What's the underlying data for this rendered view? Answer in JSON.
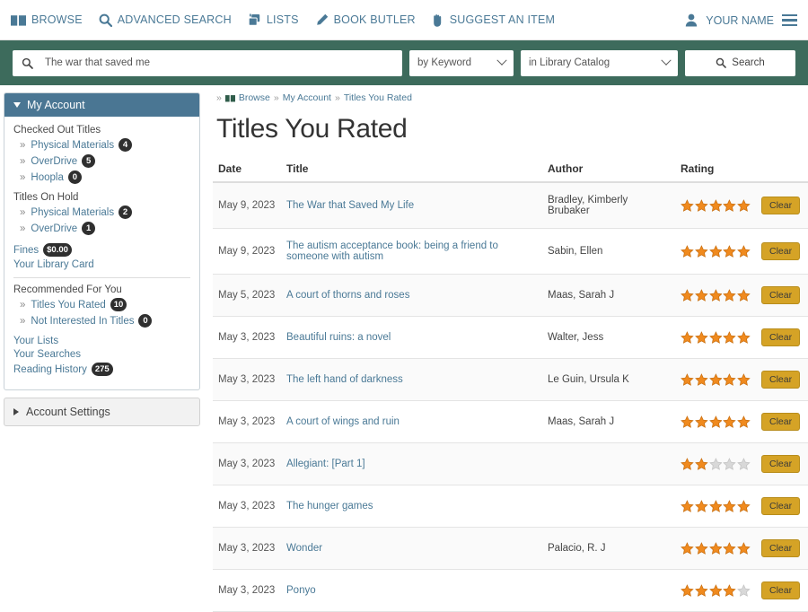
{
  "topnav": {
    "items": [
      {
        "label": "BROWSE",
        "icon": "book-icon"
      },
      {
        "label": "ADVANCED SEARCH",
        "icon": "search-icon"
      },
      {
        "label": "LISTS",
        "icon": "lists-icon"
      },
      {
        "label": "BOOK BUTLER",
        "icon": "pencil-icon"
      },
      {
        "label": "SUGGEST AN ITEM",
        "icon": "hand-icon"
      }
    ],
    "account_label": "YOUR NAME",
    "account_icon": "user-icon",
    "menu_icon": "hamburger-icon"
  },
  "search": {
    "query": "The war that saved me",
    "placeholder": "The war that saved me",
    "field_select": "by Keyword",
    "scope_select": "in Library Catalog",
    "button_label": "Search",
    "band_color": "#3d6b5c"
  },
  "sidebar": {
    "header": "My Account",
    "header_color": "#4a7693",
    "groups": [
      {
        "title": "Checked Out Titles",
        "items": [
          {
            "label": "Physical Materials",
            "count": "4"
          },
          {
            "label": "OverDrive",
            "count": "5"
          },
          {
            "label": "Hoopla",
            "count": "0"
          }
        ]
      },
      {
        "title": "Titles On Hold",
        "items": [
          {
            "label": "Physical Materials",
            "count": "2"
          },
          {
            "label": "OverDrive",
            "count": "1"
          }
        ]
      }
    ],
    "fines_label": "Fines",
    "fines_amount": "$0.00",
    "library_card_label": "Your Library Card",
    "recommended_title": "Recommended For You",
    "recommended_items": [
      {
        "label": "Titles You Rated",
        "count": "10"
      },
      {
        "label": "Not Interested In Titles",
        "count": "0"
      }
    ],
    "links": [
      {
        "label": "Your Lists",
        "count": ""
      },
      {
        "label": "Your Searches",
        "count": ""
      },
      {
        "label": "Reading History",
        "count": "275"
      }
    ],
    "account_settings": "Account Settings"
  },
  "breadcrumb": {
    "items": [
      "Browse",
      "My Account",
      "Titles You Rated"
    ]
  },
  "main": {
    "page_title": "Titles You Rated",
    "columns": [
      "Date",
      "Title",
      "Author",
      "Rating",
      ""
    ],
    "clear_label": "Clear",
    "star_filled_color": "#f08a1e",
    "star_empty_color": "#d8d8d8",
    "rows": [
      {
        "date": "May 9, 2023",
        "title": "The War that Saved My Life",
        "author": "Bradley, Kimberly Brubaker",
        "rating": 5
      },
      {
        "date": "May 9, 2023",
        "title": "The autism acceptance book: being a friend to someone with autism",
        "author": "Sabin, Ellen",
        "rating": 5
      },
      {
        "date": "May 5, 2023",
        "title": "A court of thorns and roses",
        "author": "Maas, Sarah J",
        "rating": 5
      },
      {
        "date": "May 3, 2023",
        "title": "Beautiful ruins: a novel",
        "author": "Walter, Jess",
        "rating": 5
      },
      {
        "date": "May 3, 2023",
        "title": "The left hand of darkness",
        "author": "Le Guin, Ursula K",
        "rating": 5
      },
      {
        "date": "May 3, 2023",
        "title": "A court of wings and ruin",
        "author": "Maas, Sarah J",
        "rating": 5
      },
      {
        "date": "May 3, 2023",
        "title": "Allegiant: [Part 1]",
        "author": "",
        "rating": 2
      },
      {
        "date": "May 3, 2023",
        "title": "The hunger games",
        "author": "",
        "rating": 5
      },
      {
        "date": "May 3, 2023",
        "title": "Wonder",
        "author": "Palacio, R. J",
        "rating": 5
      },
      {
        "date": "May 3, 2023",
        "title": "Ponyo",
        "author": "",
        "rating": 4
      }
    ]
  }
}
